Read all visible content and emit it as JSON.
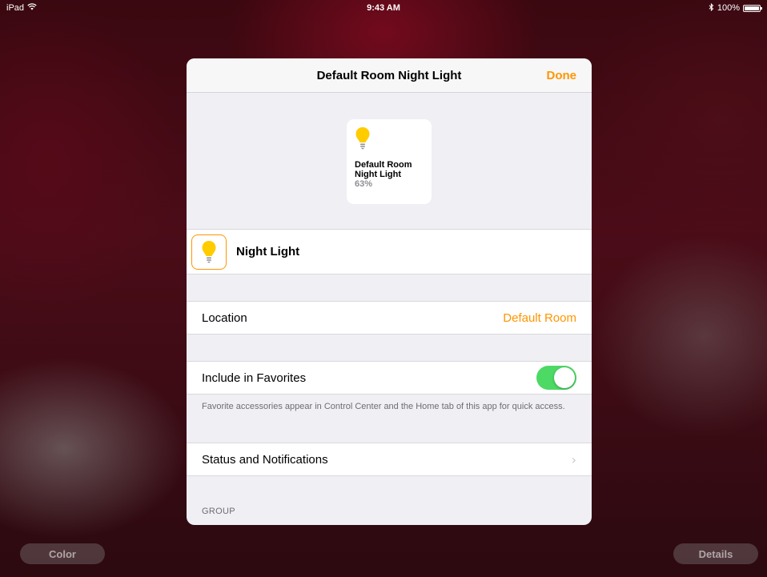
{
  "status_bar": {
    "device": "iPad",
    "time": "9:43 AM",
    "battery": "100%"
  },
  "modal": {
    "title": "Default Room Night Light",
    "done_label": "Done",
    "tile": {
      "name": "Default Room Night Light",
      "status": "63%",
      "icon": "lightbulb-icon"
    },
    "accessory_name": "Night Light",
    "location": {
      "label": "Location",
      "value": "Default Room"
    },
    "favorites": {
      "label": "Include in Favorites",
      "enabled": true,
      "footnote": "Favorite accessories appear in Control Center and the Home tab of this app for quick access."
    },
    "status_notifications": {
      "label": "Status and Notifications"
    },
    "group_header": "GROUP"
  },
  "bottom_buttons": {
    "color_label": "Color",
    "details_label": "Details"
  },
  "colors": {
    "accent": "#ff9500",
    "toggle_on": "#4cd964",
    "bulb": "#ffcc00"
  }
}
